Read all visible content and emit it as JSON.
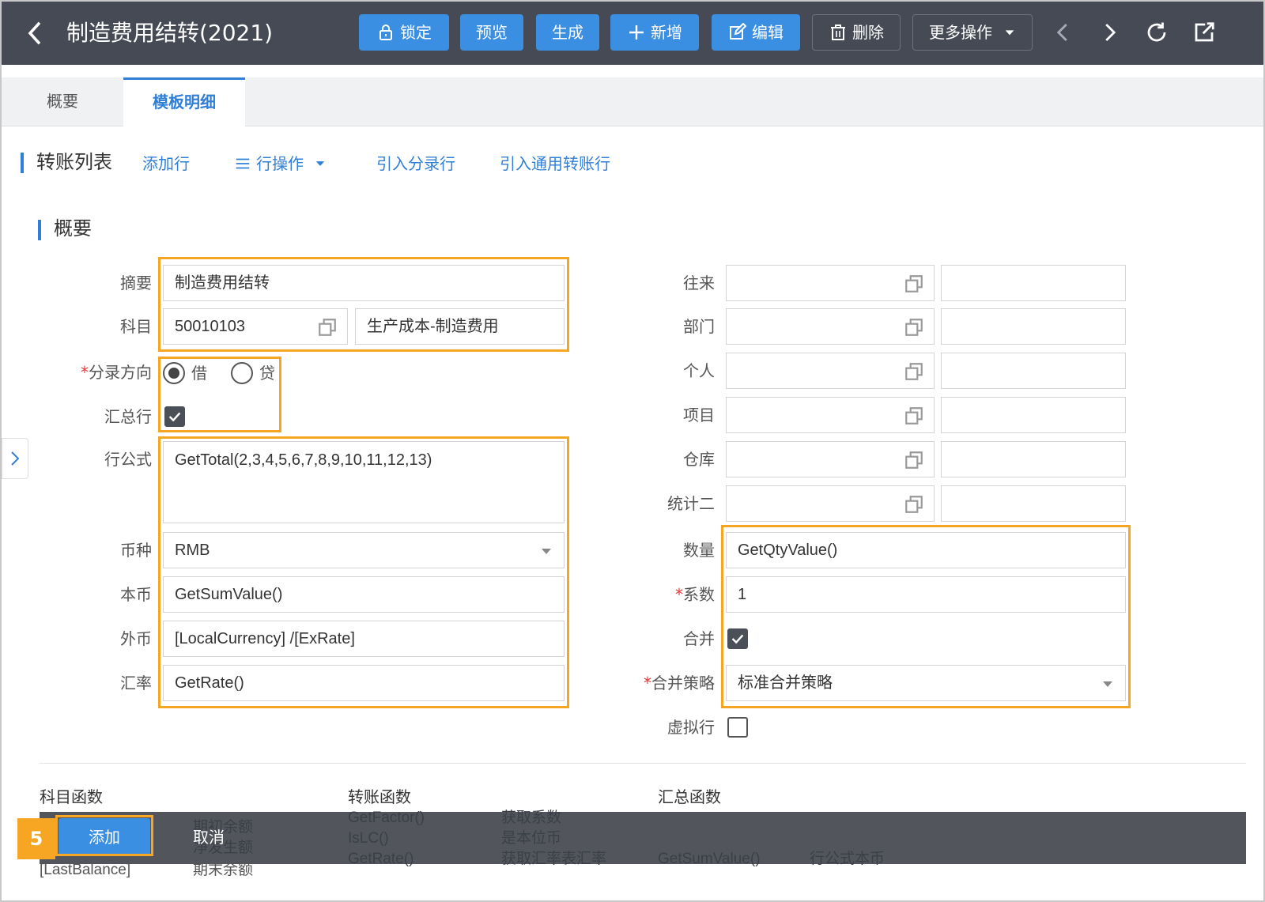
{
  "header": {
    "title": "制造费用结转(2021)",
    "buttons": {
      "lock": "锁定",
      "preview": "预览",
      "generate": "生成",
      "add": "新增",
      "edit": "编辑",
      "delete": "删除",
      "more": "更多操作"
    }
  },
  "tabs": [
    "概要",
    "模板明细"
  ],
  "toolbar": {
    "section_title": "转账列表",
    "add_row": "添加行",
    "row_ops": "行操作",
    "import_entry": "引入分录行",
    "import_general": "引入通用转账行"
  },
  "form": {
    "section_title": "概要",
    "summary_label": "摘要",
    "summary_value": "制造费用结转",
    "account_label": "科目",
    "account_code": "50010103",
    "account_name": "生产成本-制造费用",
    "direction_label": "分录方向",
    "debit": "借",
    "credit": "贷",
    "summary_row_label": "汇总行",
    "formula_label": "行公式",
    "formula_value": "GetTotal(2,3,4,5,6,7,8,9,10,11,12,13)",
    "currency_label": "币种",
    "currency_value": "RMB",
    "local_label": "本币",
    "local_value": "GetSumValue()",
    "foreign_label": "外币",
    "foreign_value": "[LocalCurrency] /[ExRate]",
    "rate_label": "汇率",
    "rate_value": "GetRate()",
    "right_labels": [
      "往来",
      "部门",
      "个人",
      "项目",
      "仓库",
      "统计二"
    ],
    "qty_label": "数量",
    "qty_value": "GetQtyValue()",
    "coef_label": "系数",
    "coef_value": "1",
    "merge_label": "合并",
    "strategy_label": "合并策略",
    "strategy_value": "标准合并策略",
    "virtual_label": "虚拟行"
  },
  "functions": {
    "account_fn": "科目函数",
    "transfer_fn": "转账函数",
    "summary_fn": "汇总函数",
    "col1": [
      "期初余额",
      "净发生额",
      "期末余额"
    ],
    "col1_code": "[LastBalance]",
    "col2": [
      "GetFactor()",
      "IsLC()",
      "GetRate()"
    ],
    "col3": [
      "获取系数",
      "是本位币",
      "获取汇率表汇率"
    ],
    "col4": "GetSumValue()",
    "col5": "行公式本币"
  },
  "bottom": {
    "step": "5",
    "add": "添加",
    "cancel": "取消"
  }
}
